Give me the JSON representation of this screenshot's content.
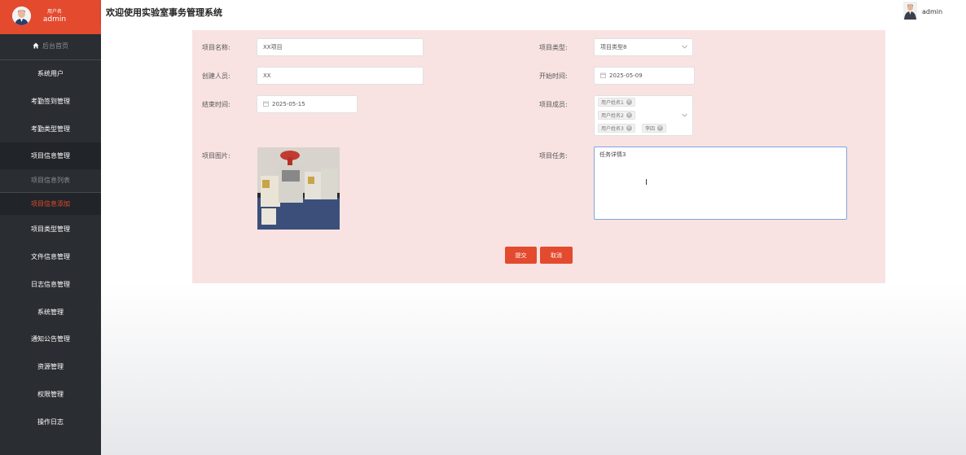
{
  "sidebar": {
    "user": {
      "name_small": "用户名",
      "name": "admin"
    },
    "items": [
      {
        "label": "后台首页",
        "icon": "home-icon"
      },
      {
        "label": "系统用户"
      },
      {
        "label": "考勤签到管理"
      },
      {
        "label": "考勤类型管理"
      },
      {
        "label": "项目信息管理"
      },
      {
        "label": "项目信息列表"
      },
      {
        "label": "项目信息添加"
      },
      {
        "label": "项目类型管理"
      },
      {
        "label": "文件信息管理"
      },
      {
        "label": "日志信息管理"
      },
      {
        "label": "系统管理"
      },
      {
        "label": "通知公告管理"
      },
      {
        "label": "资源管理"
      },
      {
        "label": "权限管理"
      },
      {
        "label": "操作日志"
      }
    ]
  },
  "header": {
    "title": "欢迎使用实验室事务管理系统",
    "user": "admin"
  },
  "form": {
    "project_name": {
      "label": "项目名称:",
      "value": "XX项目"
    },
    "project_type": {
      "label": "项目类型:",
      "value": "项目类型8"
    },
    "creator": {
      "label": "创建人员:",
      "value": "XX"
    },
    "start_time": {
      "label": "开始时间:",
      "value": "2025-05-09"
    },
    "end_time": {
      "label": "结束时间:",
      "value": "2025-05-15"
    },
    "members": {
      "label": "项目成员:",
      "tags": [
        "用户姓名1",
        "用户姓名2",
        "用户姓名3",
        "李四"
      ]
    },
    "image": {
      "label": "项目图片:"
    },
    "task": {
      "label": "项目任务:",
      "value": "任务详情3"
    },
    "submit_label": "提交",
    "cancel_label": "取消"
  },
  "colors": {
    "accent": "#e34a2e",
    "sidebar": "#2a2d32",
    "panel": "#f8e3e2"
  }
}
